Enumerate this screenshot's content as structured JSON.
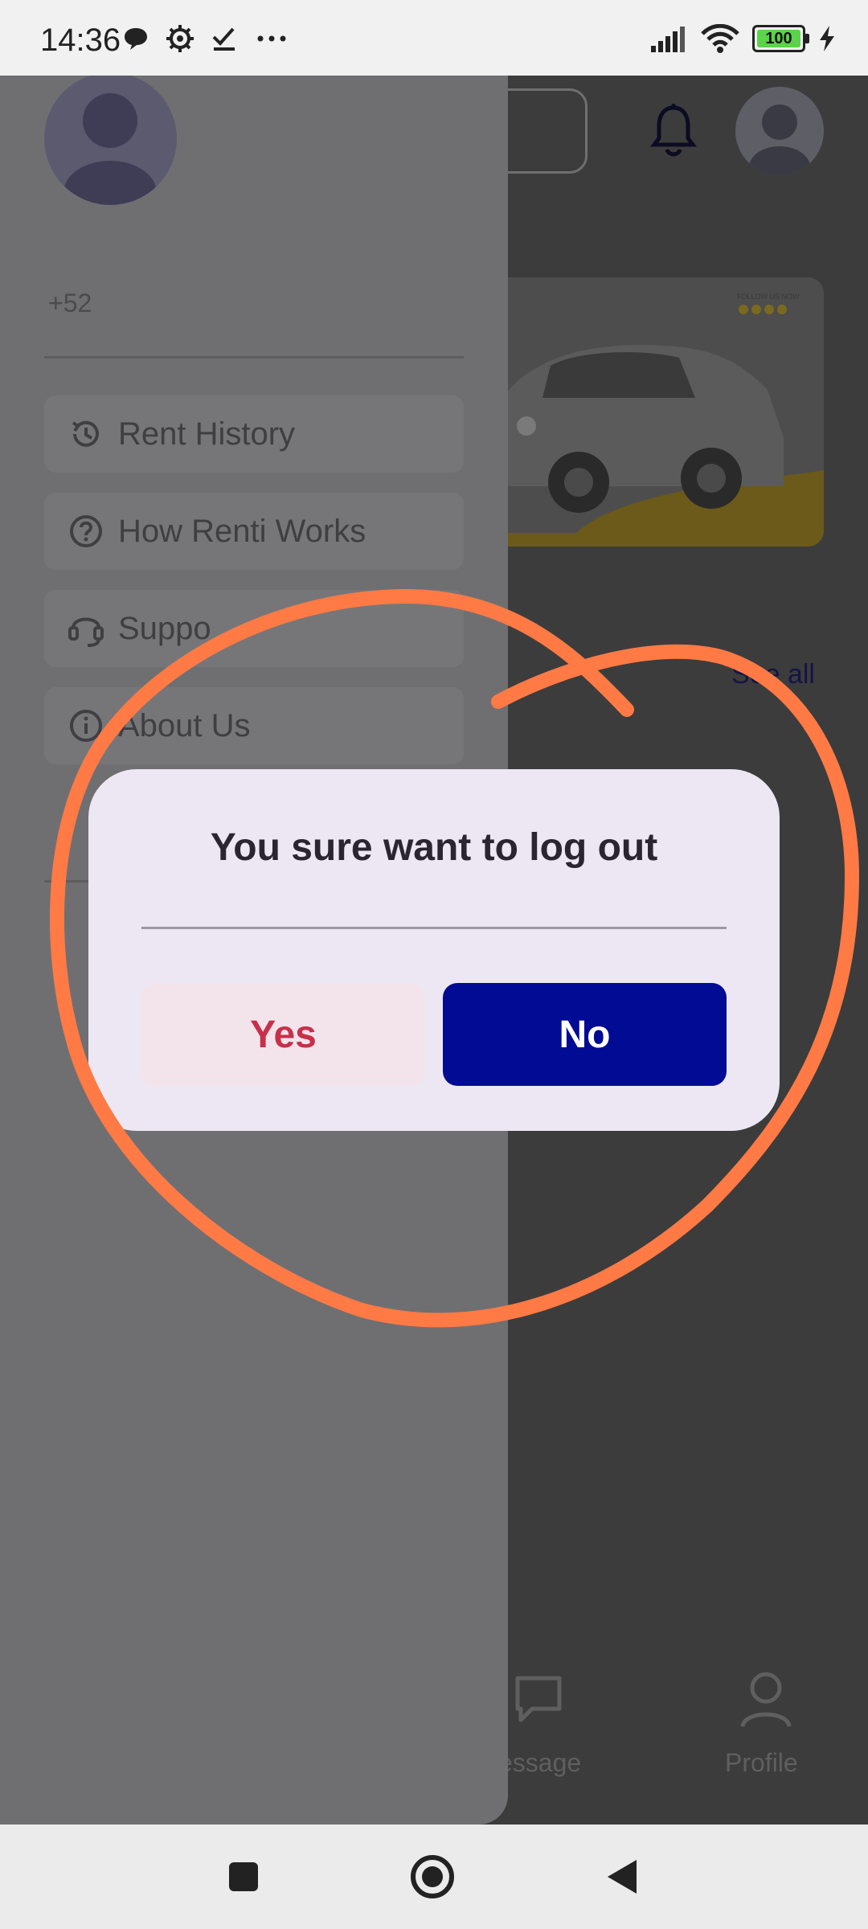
{
  "status_bar": {
    "time": "14:36",
    "battery": "100",
    "icons_left": [
      "chat-bubble-icon",
      "settings-gear-icon",
      "check-icon",
      "more-dots-icon"
    ],
    "icons_right": [
      "signal-icon",
      "wifi-icon",
      "battery-icon",
      "charging-icon"
    ]
  },
  "background_app": {
    "see_all": "See all",
    "nav_message": "essage",
    "nav_profile": "Profile",
    "banner_text": "FOLLOW US NOW"
  },
  "drawer": {
    "phone": "+52",
    "items": [
      {
        "label": "Rent History",
        "icon": "history-icon"
      },
      {
        "label": "How Renti Works",
        "icon": "question-icon"
      },
      {
        "label": "Suppo",
        "icon": "headset-icon"
      },
      {
        "label": "About Us",
        "icon": "info-icon"
      }
    ]
  },
  "dialog": {
    "title": "You sure want to log out",
    "yes_label": "Yes",
    "no_label": "No"
  },
  "colors": {
    "no_button": "#020b94",
    "yes_text": "#c8304a",
    "annotation": "#ff7a45"
  }
}
